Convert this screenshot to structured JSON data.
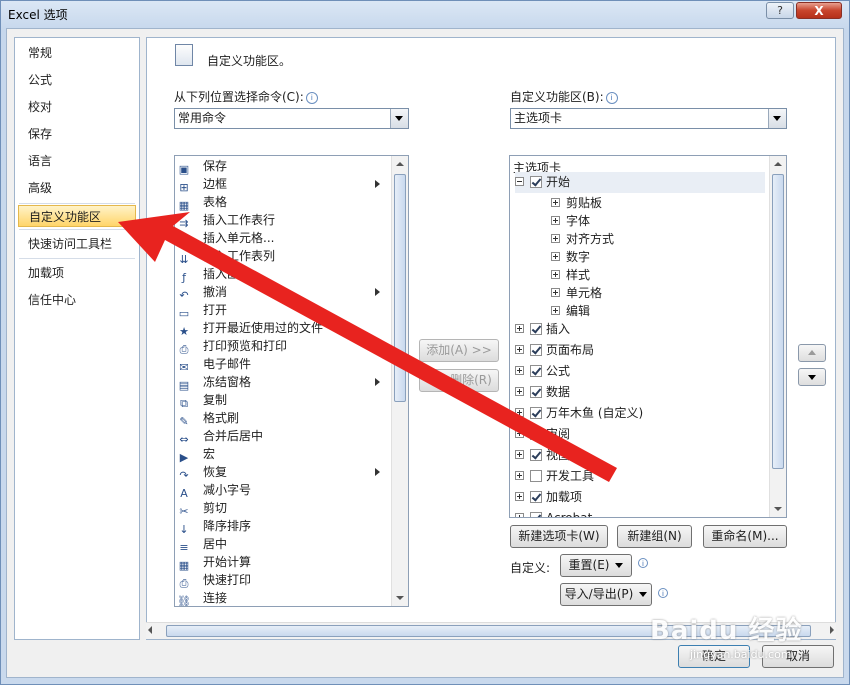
{
  "window": {
    "title": "Excel 选项",
    "help": "?",
    "close": "X"
  },
  "nav": {
    "items": [
      {
        "label": "常规"
      },
      {
        "label": "公式"
      },
      {
        "label": "校对"
      },
      {
        "label": "保存"
      },
      {
        "label": "语言"
      },
      {
        "label": "高级"
      },
      {
        "label": "自定义功能区",
        "selected": true
      },
      {
        "label": "快速访问工具栏"
      },
      {
        "label": "加载项"
      },
      {
        "label": "信任中心"
      }
    ]
  },
  "header": {
    "title": "自定义功能区。"
  },
  "left": {
    "label": "从下列位置选择命令(C):",
    "selected": "常用命令",
    "commands": [
      {
        "label": "保存",
        "icon": "save-icon"
      },
      {
        "label": "边框",
        "icon": "border-icon",
        "submenu": true
      },
      {
        "label": "表格",
        "icon": "table-icon"
      },
      {
        "label": "插入工作表行",
        "icon": "insert-row-icon"
      },
      {
        "label": "插入单元格...",
        "icon": "insert-cells-icon"
      },
      {
        "label": "插入工作表列",
        "icon": "insert-column-icon"
      },
      {
        "label": "插入函数...",
        "icon": "function-icon"
      },
      {
        "label": "撤消",
        "icon": "undo-icon",
        "submenu": true
      },
      {
        "label": "打开",
        "icon": "open-folder-icon"
      },
      {
        "label": "打开最近使用过的文件",
        "icon": "recent-file-icon"
      },
      {
        "label": "打印预览和打印",
        "icon": "print-preview-icon"
      },
      {
        "label": "电子邮件",
        "icon": "email-icon"
      },
      {
        "label": "冻结窗格",
        "icon": "freeze-panes-icon",
        "submenu": true
      },
      {
        "label": "复制",
        "icon": "copy-icon"
      },
      {
        "label": "格式刷",
        "icon": "format-painter-icon"
      },
      {
        "label": "合并后居中",
        "icon": "merge-center-icon"
      },
      {
        "label": "宏",
        "icon": "macro-icon"
      },
      {
        "label": "恢复",
        "icon": "redo-icon",
        "submenu": true
      },
      {
        "label": "减小字号",
        "icon": "decrease-font-icon"
      },
      {
        "label": "剪切",
        "icon": "cut-icon"
      },
      {
        "label": "降序排序",
        "icon": "sort-descending-icon"
      },
      {
        "label": "居中",
        "icon": "center-align-icon"
      },
      {
        "label": "开始计算",
        "icon": "calculate-icon"
      },
      {
        "label": "快速打印",
        "icon": "quick-print-icon"
      },
      {
        "label": "连接",
        "icon": "connections-icon"
      }
    ]
  },
  "middle": {
    "add": "添加(A) >>",
    "remove": "<< 删除(R)"
  },
  "right": {
    "label": "自定义功能区(B):",
    "selected": "主选项卡",
    "tree_header": "主选项卡",
    "tree": [
      {
        "label": "开始",
        "level": 0,
        "expanded": true,
        "checked": true
      },
      {
        "label": "剪贴板",
        "level": 1
      },
      {
        "label": "字体",
        "level": 1
      },
      {
        "label": "对齐方式",
        "level": 1
      },
      {
        "label": "数字",
        "level": 1
      },
      {
        "label": "样式",
        "level": 1
      },
      {
        "label": "单元格",
        "level": 1
      },
      {
        "label": "编辑",
        "level": 1
      },
      {
        "label": "插入",
        "level": 0,
        "checked": true
      },
      {
        "label": "页面布局",
        "level": 0,
        "checked": true
      },
      {
        "label": "公式",
        "level": 0,
        "checked": true
      },
      {
        "label": "数据",
        "level": 0,
        "checked": true
      },
      {
        "label": "万年木鱼 (自定义)",
        "level": 0,
        "checked": true
      },
      {
        "label": "审阅",
        "level": 0,
        "checked": true
      },
      {
        "label": "视图",
        "level": 0,
        "checked": true
      },
      {
        "label": "开发工具",
        "level": 0,
        "checked": false
      },
      {
        "label": "加载项",
        "level": 0,
        "checked": true
      },
      {
        "label": "Acrobat",
        "level": 0,
        "checked": true
      }
    ],
    "new_tab": "新建选项卡(W)",
    "new_group": "新建组(N)",
    "rename": "重命名(M)...",
    "customize_label": "自定义:",
    "reset": "重置(E)",
    "import_export": "导入/导出(P)"
  },
  "footer": {
    "ok": "确定",
    "cancel": "取消"
  },
  "watermark": {
    "text": "Baidu 经验",
    "sub": "jingyan.baidu.com"
  },
  "colors": {
    "arrow": "#e8231f",
    "selection": "#ffd56a"
  }
}
